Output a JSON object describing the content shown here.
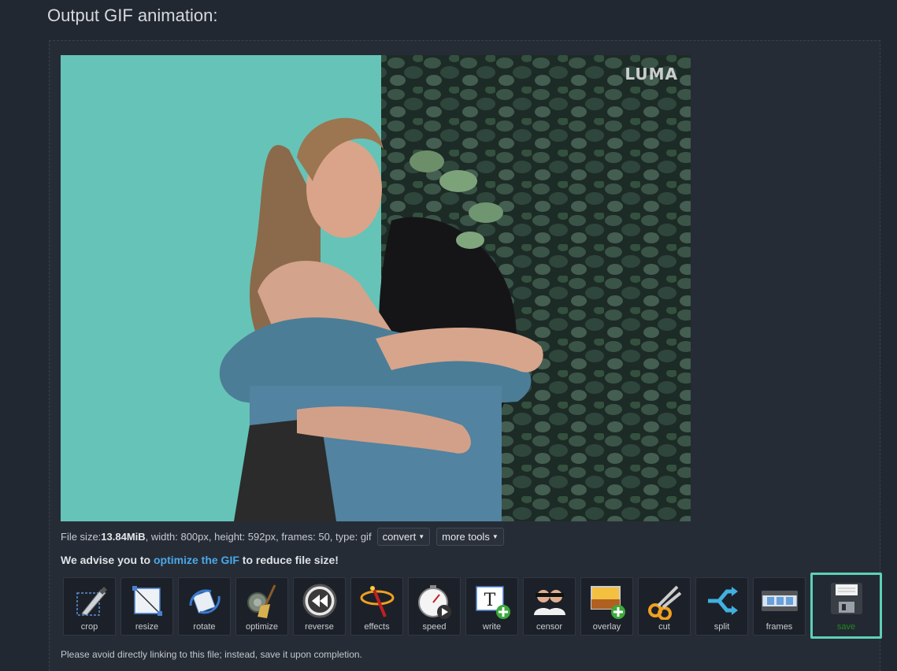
{
  "page": {
    "title": "Output GIF animation:"
  },
  "gif": {
    "watermark": "LUMA"
  },
  "info": {
    "prefix": "File size: ",
    "size": "13.84MiB",
    "details": ", width: 800px, height: 592px, frames: 50, type: gif",
    "convert_label": "convert",
    "more_tools_label": "more tools"
  },
  "advise": {
    "before": "We advise you to ",
    "link": "optimize the GIF",
    "after": " to reduce file size!"
  },
  "tools": {
    "crop": "crop",
    "resize": "resize",
    "rotate": "rotate",
    "optimize": "optimize",
    "reverse": "reverse",
    "effects": "effects",
    "speed": "speed",
    "write": "write",
    "censor": "censor",
    "overlay": "overlay",
    "cut": "cut",
    "split": "split",
    "frames": "frames",
    "save": "save"
  },
  "note": "Please avoid directly linking to this file; instead, save it upon completion.",
  "colors": {
    "accent": "#4aa8e8",
    "highlight": "#5ed0b8",
    "background": "#222831"
  }
}
